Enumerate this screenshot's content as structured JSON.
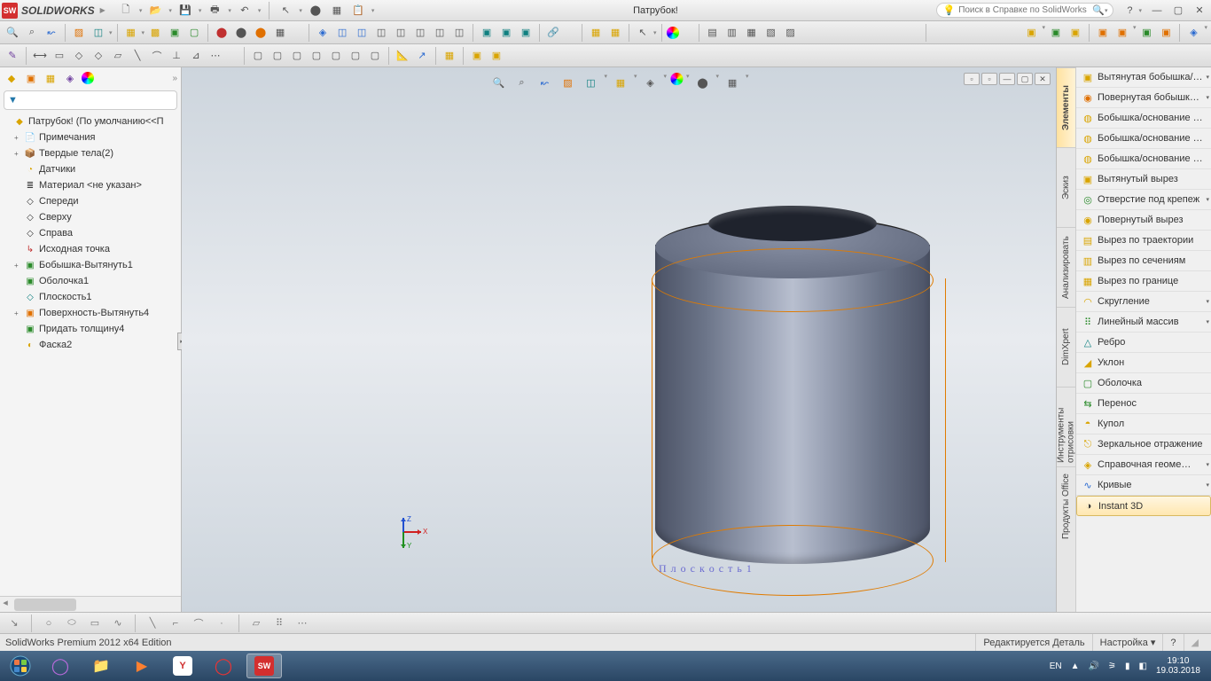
{
  "title": {
    "brand": "SOLIDWORKS",
    "doc": "Патрубок!",
    "search_placeholder": "Поиск в Справке по SolidWorks"
  },
  "tree": {
    "root": "Патрубок!  (По умолчанию<<П",
    "items": [
      {
        "icon": "📄",
        "label": "Примечания",
        "exp": "+",
        "cls": "c-yellow"
      },
      {
        "icon": "📦",
        "label": "Твердые тела(2)",
        "exp": "+",
        "cls": "c-yellow"
      },
      {
        "icon": "◔",
        "label": "Датчики",
        "exp": "",
        "cls": "c-yellow"
      },
      {
        "icon": "≣",
        "label": "Материал <не указан>",
        "exp": "",
        "cls": ""
      },
      {
        "icon": "◇",
        "label": "Спереди",
        "exp": "",
        "cls": ""
      },
      {
        "icon": "◇",
        "label": "Сверху",
        "exp": "",
        "cls": ""
      },
      {
        "icon": "◇",
        "label": "Справа",
        "exp": "",
        "cls": ""
      },
      {
        "icon": "↳",
        "label": "Исходная точка",
        "exp": "",
        "cls": "c-red"
      },
      {
        "icon": "▣",
        "label": "Бобышка-Вытянуть1",
        "exp": "+",
        "cls": "c-green"
      },
      {
        "icon": "▣",
        "label": "Оболочка1",
        "exp": "",
        "cls": "c-green"
      },
      {
        "icon": "◇",
        "label": "Плоскость1",
        "exp": "",
        "cls": "c-teal"
      },
      {
        "icon": "▣",
        "label": "Поверхность-Вытянуть4",
        "exp": "+",
        "cls": "c-orange"
      },
      {
        "icon": "▣",
        "label": "Придать толщину4",
        "exp": "",
        "cls": "c-green"
      },
      {
        "icon": "◐",
        "label": "Фаска2",
        "exp": "",
        "cls": "c-yellow"
      }
    ]
  },
  "plane_label": "П л о с к о с т ь 1",
  "right_tabs": [
    "Элементы",
    "Эскиз",
    "Анализировать",
    "DimXpert",
    "Инструменты отрисовки",
    "Продукты Office"
  ],
  "features": [
    {
      "icon": "▣",
      "label": "Вытянутая бобышка/…",
      "dd": true,
      "cls": "c-yellow"
    },
    {
      "icon": "◉",
      "label": "Повернутая бобышк…",
      "dd": true,
      "cls": "c-orange"
    },
    {
      "icon": "◍",
      "label": "Бобышка/основание …",
      "dd": false,
      "cls": "c-yellow"
    },
    {
      "icon": "◍",
      "label": "Бобышка/основание …",
      "dd": false,
      "cls": "c-yellow"
    },
    {
      "icon": "◍",
      "label": "Бобышка/основание …",
      "dd": false,
      "cls": "c-yellow"
    },
    {
      "icon": "▣",
      "label": "Вытянутый вырез",
      "dd": false,
      "cls": "c-yellow"
    },
    {
      "icon": "◎",
      "label": "Отверстие под крепеж",
      "dd": true,
      "cls": "c-green"
    },
    {
      "icon": "◉",
      "label": "Повернутый вырез",
      "dd": false,
      "cls": "c-yellow"
    },
    {
      "icon": "▤",
      "label": "Вырез по траектории",
      "dd": false,
      "cls": "c-yellow"
    },
    {
      "icon": "▥",
      "label": "Вырез по сечениям",
      "dd": false,
      "cls": "c-yellow"
    },
    {
      "icon": "▦",
      "label": "Вырез по границе",
      "dd": false,
      "cls": "c-yellow"
    },
    {
      "icon": "◠",
      "label": "Скругление",
      "dd": true,
      "cls": "c-yellow"
    },
    {
      "icon": "⠿",
      "label": "Линейный массив",
      "dd": true,
      "cls": "c-green"
    },
    {
      "icon": "△",
      "label": "Ребро",
      "dd": false,
      "cls": "c-teal"
    },
    {
      "icon": "◢",
      "label": "Уклон",
      "dd": false,
      "cls": "c-yellow"
    },
    {
      "icon": "▢",
      "label": "Оболочка",
      "dd": false,
      "cls": "c-green"
    },
    {
      "icon": "⇆",
      "label": "Перенос",
      "dd": false,
      "cls": "c-green"
    },
    {
      "icon": "◓",
      "label": "Купол",
      "dd": false,
      "cls": "c-yellow"
    },
    {
      "icon": "⎋",
      "label": "Зеркальное отражение",
      "dd": false,
      "cls": "c-yellow"
    },
    {
      "icon": "◈",
      "label": "Справочная геоме…",
      "dd": true,
      "cls": "c-yellow"
    },
    {
      "icon": "∿",
      "label": "Кривые",
      "dd": true,
      "cls": "c-blue"
    },
    {
      "icon": "◑",
      "label": "Instant 3D",
      "dd": false,
      "cls": "",
      "active": true
    }
  ],
  "status": {
    "left": "SolidWorks Premium 2012 x64 Edition",
    "editing": "Редактируется Деталь",
    "settings": "Настройка"
  },
  "taskbar": {
    "lang": "EN",
    "time": "19:10",
    "date": "19.03.2018"
  },
  "triad": {
    "x": "X",
    "y": "Y",
    "z": "Z"
  }
}
